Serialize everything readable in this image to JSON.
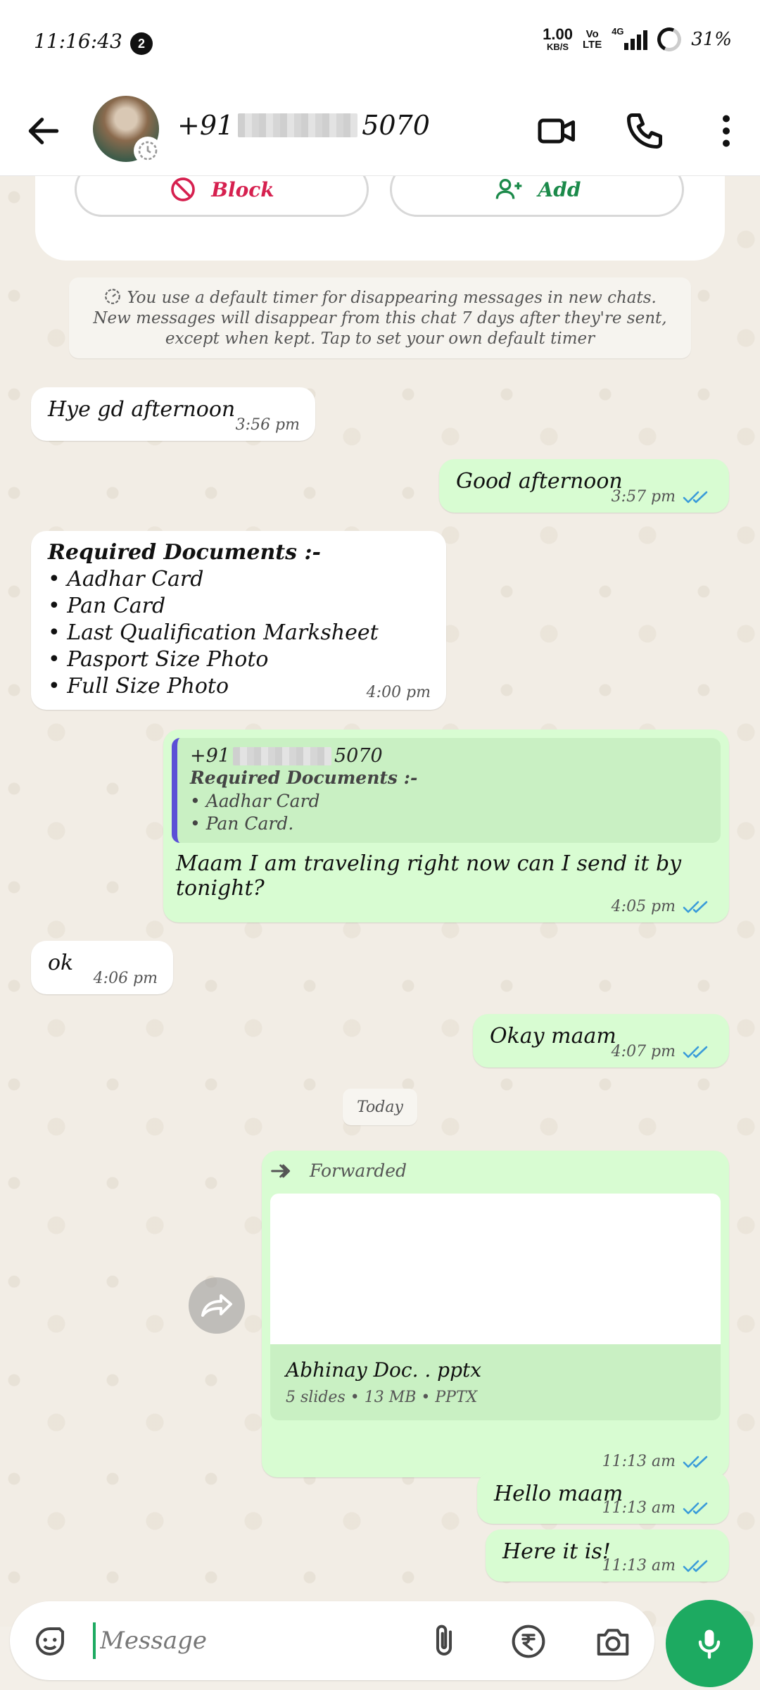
{
  "status_bar": {
    "time": "11:16:43",
    "notification_count": "2",
    "net_speed": "1.00",
    "net_unit": "KB/S",
    "volte_top": "Vo",
    "volte_bottom": "LTE",
    "network": "4G",
    "battery": "31%"
  },
  "header": {
    "contact_prefix": "+91",
    "contact_suffix": "5070",
    "icons": [
      "back-arrow-icon",
      "video-call-icon",
      "phone-icon",
      "more-vert-icon"
    ]
  },
  "contact_card": {
    "block_label": "Block",
    "add_label": "Add"
  },
  "system_message": "You use a default timer for disappearing messages in new chats. New messages will disappear from this chat 7 days after they're sent, except when kept. Tap to set your own default timer",
  "messages": [
    {
      "text": "Hye gd afternoon",
      "time": "3:56 pm"
    },
    {
      "text": "Good afternoon",
      "time": "3:57 pm"
    },
    {
      "title": "Required Documents :-",
      "lines": [
        "• Aadhar Card",
        "• Pan Card",
        "• Last Qualification Marksheet",
        "• Pasport Size Photo",
        "• Full Size Photo"
      ],
      "time": "4:00 pm"
    },
    {
      "quote_prefix": "+91",
      "quote_suffix": "5070",
      "quote_title": "Required Documents :-",
      "quote_lines": [
        "• Aadhar Card",
        "• Pan Card."
      ],
      "text": "Maam I am traveling right now can I send it by tonight?",
      "time": "4:05 pm"
    },
    {
      "text": "ok",
      "time": "4:06 pm"
    },
    {
      "text": "Okay maam",
      "time": "4:07 pm"
    }
  ],
  "date_chip": "Today",
  "forwarded": {
    "label": "Forwarded",
    "doc_name": "Abhinay Doc. . pptx",
    "doc_meta": "5 slides • 13 MB • PPTX",
    "time": "11:13 am"
  },
  "later_messages": [
    {
      "text": "Hello maam",
      "time": "11:13 am"
    },
    {
      "text": "Here it is!",
      "time": "11:13 am"
    }
  ],
  "input": {
    "placeholder": "Message"
  },
  "colors": {
    "accent_green": "#1daa61",
    "outgoing_bubble": "#d8fcd2",
    "read_ticks": "#3a9bd9",
    "block_red": "#d6204f"
  }
}
